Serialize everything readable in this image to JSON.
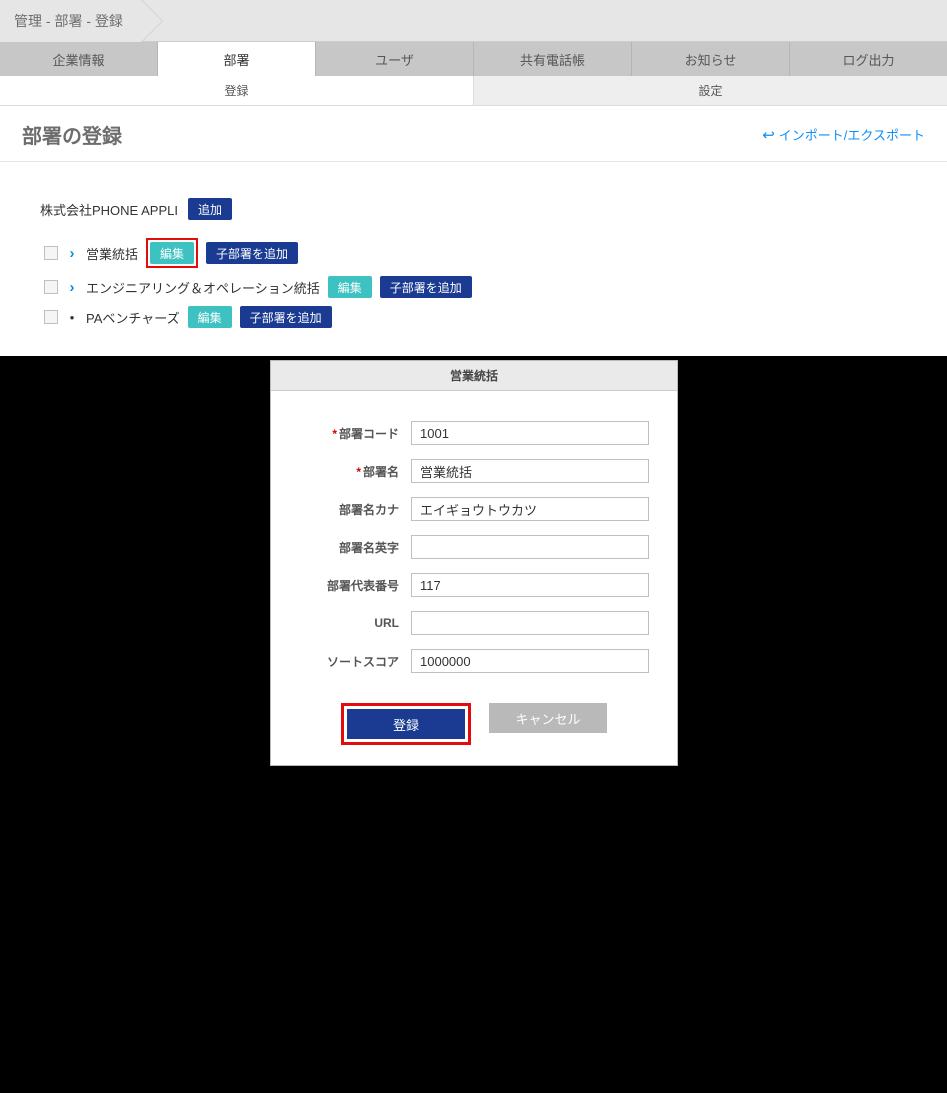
{
  "breadcrumb": "管理 - 部署 - 登録",
  "mainTabs": [
    "企業情報",
    "部署",
    "ユーザ",
    "共有電話帳",
    "お知らせ",
    "ログ出力"
  ],
  "mainTabActive": 1,
  "subTabs": [
    "登録",
    "設定"
  ],
  "subTabActive": 0,
  "pageTitle": "部署の登録",
  "importExport": "インポート/エクスポート",
  "company": {
    "name": "株式会社PHONE APPLI",
    "addLabel": "追加"
  },
  "editLabel": "編集",
  "addChildLabel": "子部署を追加",
  "departments": [
    {
      "name": "営業統括",
      "hasChildren": true,
      "highlightedEdit": true
    },
    {
      "name": "エンジニアリング＆オペレーション統括",
      "hasChildren": true,
      "highlightedEdit": false
    },
    {
      "name": "PAベンチャーズ",
      "hasChildren": false,
      "highlightedEdit": false
    }
  ],
  "dialog": {
    "title": "営業統括",
    "fields": {
      "deptCode": {
        "label": "部署コード",
        "value": "1001",
        "required": true
      },
      "deptName": {
        "label": "部署名",
        "value": "営業統括",
        "required": true
      },
      "deptKana": {
        "label": "部署名カナ",
        "value": "エイギョウトウカツ",
        "required": false
      },
      "deptEn": {
        "label": "部署名英字",
        "value": "",
        "required": false
      },
      "deptTel": {
        "label": "部署代表番号",
        "value": "117",
        "required": false
      },
      "url": {
        "label": "URL",
        "value": "",
        "required": false
      },
      "sortScore": {
        "label": "ソートスコア",
        "value": "1000000",
        "required": false
      }
    },
    "submitLabel": "登録",
    "cancelLabel": "キャンセル"
  }
}
